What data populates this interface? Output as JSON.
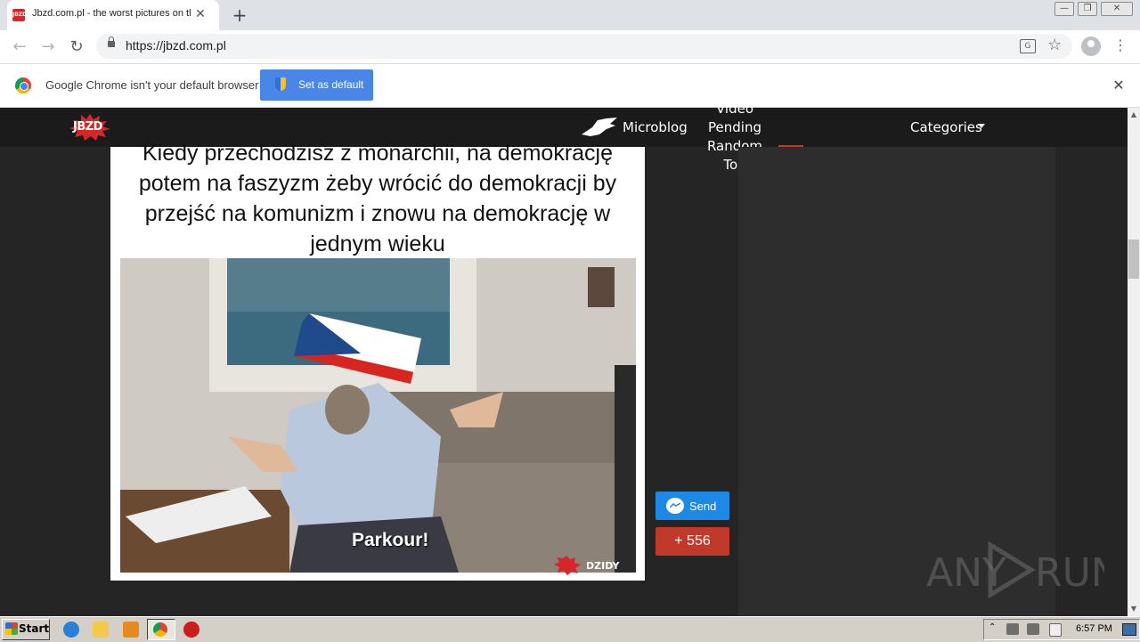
{
  "browser": {
    "tab": {
      "title": "Jbzd.com.pl - the worst pictures on the Internet",
      "favicon_text": "JBZD"
    },
    "new_tab_symbol": "+",
    "window_controls": {
      "minimize": "—",
      "maximize": "❐",
      "close": "✕"
    },
    "nav": {
      "back": "←",
      "forward": "→",
      "reload": "↻"
    },
    "url": "https://jbzd.com.pl",
    "translate_icon_text": "G",
    "star_symbol": "☆",
    "menu_symbol": "⋮",
    "infobar": {
      "message": "Google Chrome isn't your default browser",
      "button_label": "Set as default",
      "close_symbol": "✕"
    }
  },
  "site": {
    "logo_text": "JBZD",
    "nav": {
      "microblog": "Microblog",
      "video": "Video",
      "pending": "Pending",
      "random": "Random",
      "top": "Top",
      "categories": "Categories"
    },
    "post": {
      "caption": "Kiedy przechodzisz z monarchii, na demokrację potem na faszyzm żeby wrócić do demokracji by przejść na komunizm i znowu na demokrację w jednym wieku",
      "image_text": "Parkour!",
      "watermark_text": "JEB DZIDY.pl",
      "send_label": "Send",
      "vote_label": "+ 556"
    },
    "accent_color": "#c0392b",
    "messenger_color": "#1e88e5"
  },
  "overlay": {
    "brand": "ANY RUN"
  },
  "scrollbar": {
    "up": "▲",
    "down": "▼"
  },
  "taskbar": {
    "start_label": "Start",
    "tray_arrow": "⌃",
    "clock": "6:57 PM"
  }
}
